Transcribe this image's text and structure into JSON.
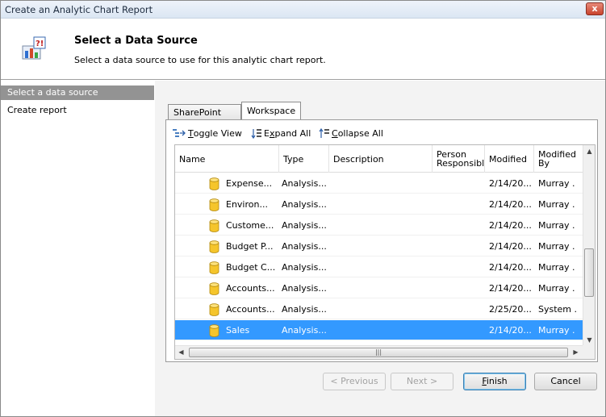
{
  "window": {
    "title": "Create an Analytic Chart Report",
    "close_label": "x"
  },
  "header": {
    "title": "Select a Data Source",
    "description": "Select a data source to use for this analytic chart report."
  },
  "nav": {
    "items": [
      {
        "label": "Select a data source",
        "selected": true
      },
      {
        "label": "Create report",
        "selected": false
      }
    ]
  },
  "tabs": [
    {
      "label": "SharePoint Site",
      "active": false
    },
    {
      "label": "Workspace",
      "active": true
    }
  ],
  "toolbar": {
    "toggle_view_u": "T",
    "toggle_view_rest": "oggle View",
    "expand_all_pre": "E",
    "expand_all_u": "x",
    "expand_all_rest": "pand All",
    "collapse_all_u": "C",
    "collapse_all_rest": "ollapse All"
  },
  "grid": {
    "columns": [
      "Name",
      "Type",
      "Description",
      "Person Responsibl",
      "Modified",
      "Modified By"
    ],
    "rows": [
      {
        "name": "Expense...",
        "type": "Analysis...",
        "description": "",
        "person": "",
        "modified": "2/14/20...",
        "modified_by": "Murray ."
      },
      {
        "name": "Environ...",
        "type": "Analysis...",
        "description": "",
        "person": "",
        "modified": "2/14/20...",
        "modified_by": "Murray ."
      },
      {
        "name": "Custome...",
        "type": "Analysis...",
        "description": "",
        "person": "",
        "modified": "2/14/20...",
        "modified_by": "Murray ."
      },
      {
        "name": "Budget P...",
        "type": "Analysis...",
        "description": "",
        "person": "",
        "modified": "2/14/20...",
        "modified_by": "Murray ."
      },
      {
        "name": "Budget C...",
        "type": "Analysis...",
        "description": "",
        "person": "",
        "modified": "2/14/20...",
        "modified_by": "Murray ."
      },
      {
        "name": "Accounts...",
        "type": "Analysis...",
        "description": "",
        "person": "",
        "modified": "2/14/20...",
        "modified_by": "Murray ."
      },
      {
        "name": "Accounts...",
        "type": "Analysis...",
        "description": "",
        "person": "",
        "modified": "2/25/20...",
        "modified_by": "System ."
      },
      {
        "name": "Sales",
        "type": "Analysis...",
        "description": "",
        "person": "",
        "modified": "2/14/20...",
        "modified_by": "Murray ."
      }
    ],
    "selected_row": 7,
    "row_icon": "database-cylinder-icon"
  },
  "buttons": {
    "previous": "< Previous",
    "next": "Next >",
    "finish_u": "F",
    "finish_rest": "inish",
    "cancel": "Cancel"
  },
  "colors": {
    "selection": "#3399ff",
    "nav_selected": "#939393",
    "cylinder": "#f5c52b"
  }
}
